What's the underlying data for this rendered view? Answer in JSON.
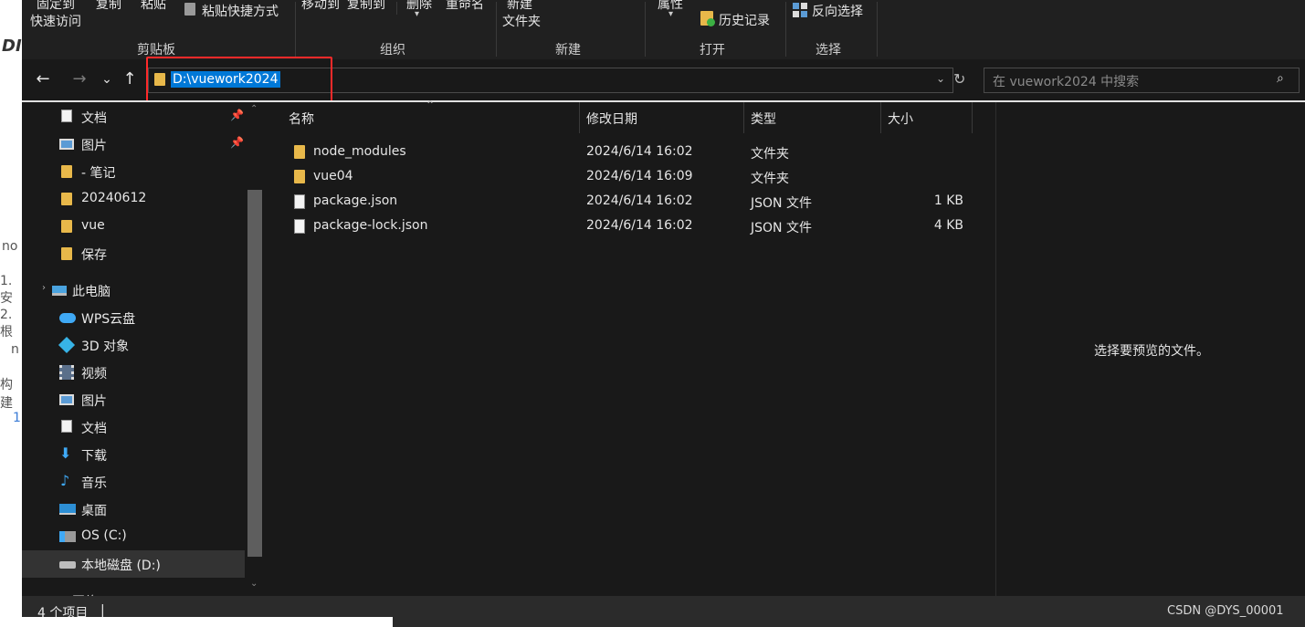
{
  "background_page": {
    "fragments": [
      "no",
      "1. 安",
      "2. 根",
      "n",
      "构建",
      "1"
    ],
    "logo_fragment": "DI"
  },
  "ribbon": {
    "clipboard": {
      "pin_quick_access_line1": "固定到",
      "pin_quick_access_line2": "快速访问",
      "copy": "复制",
      "paste": "粘贴",
      "paste_shortcut": "粘贴快捷方式",
      "group_label": "剪贴板"
    },
    "organize": {
      "move_to": "移动到",
      "copy_to": "复制到",
      "delete": "删除",
      "rename": "重命名",
      "group_label": "组织"
    },
    "new": {
      "new_folder_line1": "新建",
      "new_folder_line2": "文件夹",
      "group_label": "新建"
    },
    "open": {
      "properties": "属性",
      "history": "历史记录",
      "group_label": "打开"
    },
    "select": {
      "invert_selection": "反向选择",
      "group_label": "选择"
    }
  },
  "nav": {
    "back_glyph": "←",
    "forward_glyph": "→",
    "recent_glyph": "⌄",
    "up_glyph": "↑",
    "address": "D:\\vuework2024",
    "search_placeholder": "在 vuework2024 中搜索"
  },
  "sidebar": {
    "items": [
      {
        "label": "文档",
        "icon": "document-icon",
        "pinned": true
      },
      {
        "label": "图片",
        "icon": "pictures-icon",
        "pinned": true
      },
      {
        "label": "- 笔记",
        "icon": "folder-icon"
      },
      {
        "label": "20240612",
        "icon": "folder-icon"
      },
      {
        "label": "vue",
        "icon": "folder-icon"
      },
      {
        "label": "保存",
        "icon": "folder-icon"
      },
      {
        "label": "此电脑",
        "icon": "computer-icon"
      },
      {
        "label": "WPS云盘",
        "icon": "cloud-icon"
      },
      {
        "label": "3D 对象",
        "icon": "3d-objects-icon"
      },
      {
        "label": "视频",
        "icon": "video-icon"
      },
      {
        "label": "图片",
        "icon": "pictures-icon"
      },
      {
        "label": "文档",
        "icon": "document-icon"
      },
      {
        "label": "下载",
        "icon": "download-icon"
      },
      {
        "label": "音乐",
        "icon": "music-icon"
      },
      {
        "label": "桌面",
        "icon": "desktop-icon"
      },
      {
        "label": "OS (C:)",
        "icon": "drive-c-icon"
      },
      {
        "label": "本地磁盘 (D:)",
        "icon": "drive-d-icon",
        "selected": true
      },
      {
        "label": "网络",
        "icon": "network-icon"
      }
    ]
  },
  "filelist": {
    "columns": {
      "name": "名称",
      "modified": "修改日期",
      "type": "类型",
      "size": "大小"
    },
    "rows": [
      {
        "name": "node_modules",
        "modified": "2024/6/14 16:02",
        "type": "文件夹",
        "size": "",
        "icon": "folder-icon"
      },
      {
        "name": "vue04",
        "modified": "2024/6/14 16:09",
        "type": "文件夹",
        "size": "",
        "icon": "folder-icon"
      },
      {
        "name": "package.json",
        "modified": "2024/6/14 16:02",
        "type": "JSON 文件",
        "size": "1 KB",
        "icon": "file-icon"
      },
      {
        "name": "package-lock.json",
        "modified": "2024/6/14 16:02",
        "type": "JSON 文件",
        "size": "4 KB",
        "icon": "file-icon"
      }
    ]
  },
  "preview": {
    "message": "选择要预览的文件。"
  },
  "status": {
    "item_count": "4 个项目",
    "separator": "|"
  },
  "watermark": "CSDN @DYS_00001",
  "colors": {
    "accent_selection": "#0078d7",
    "highlight_box": "#ff2a2a",
    "folder": "#e8b84a"
  }
}
